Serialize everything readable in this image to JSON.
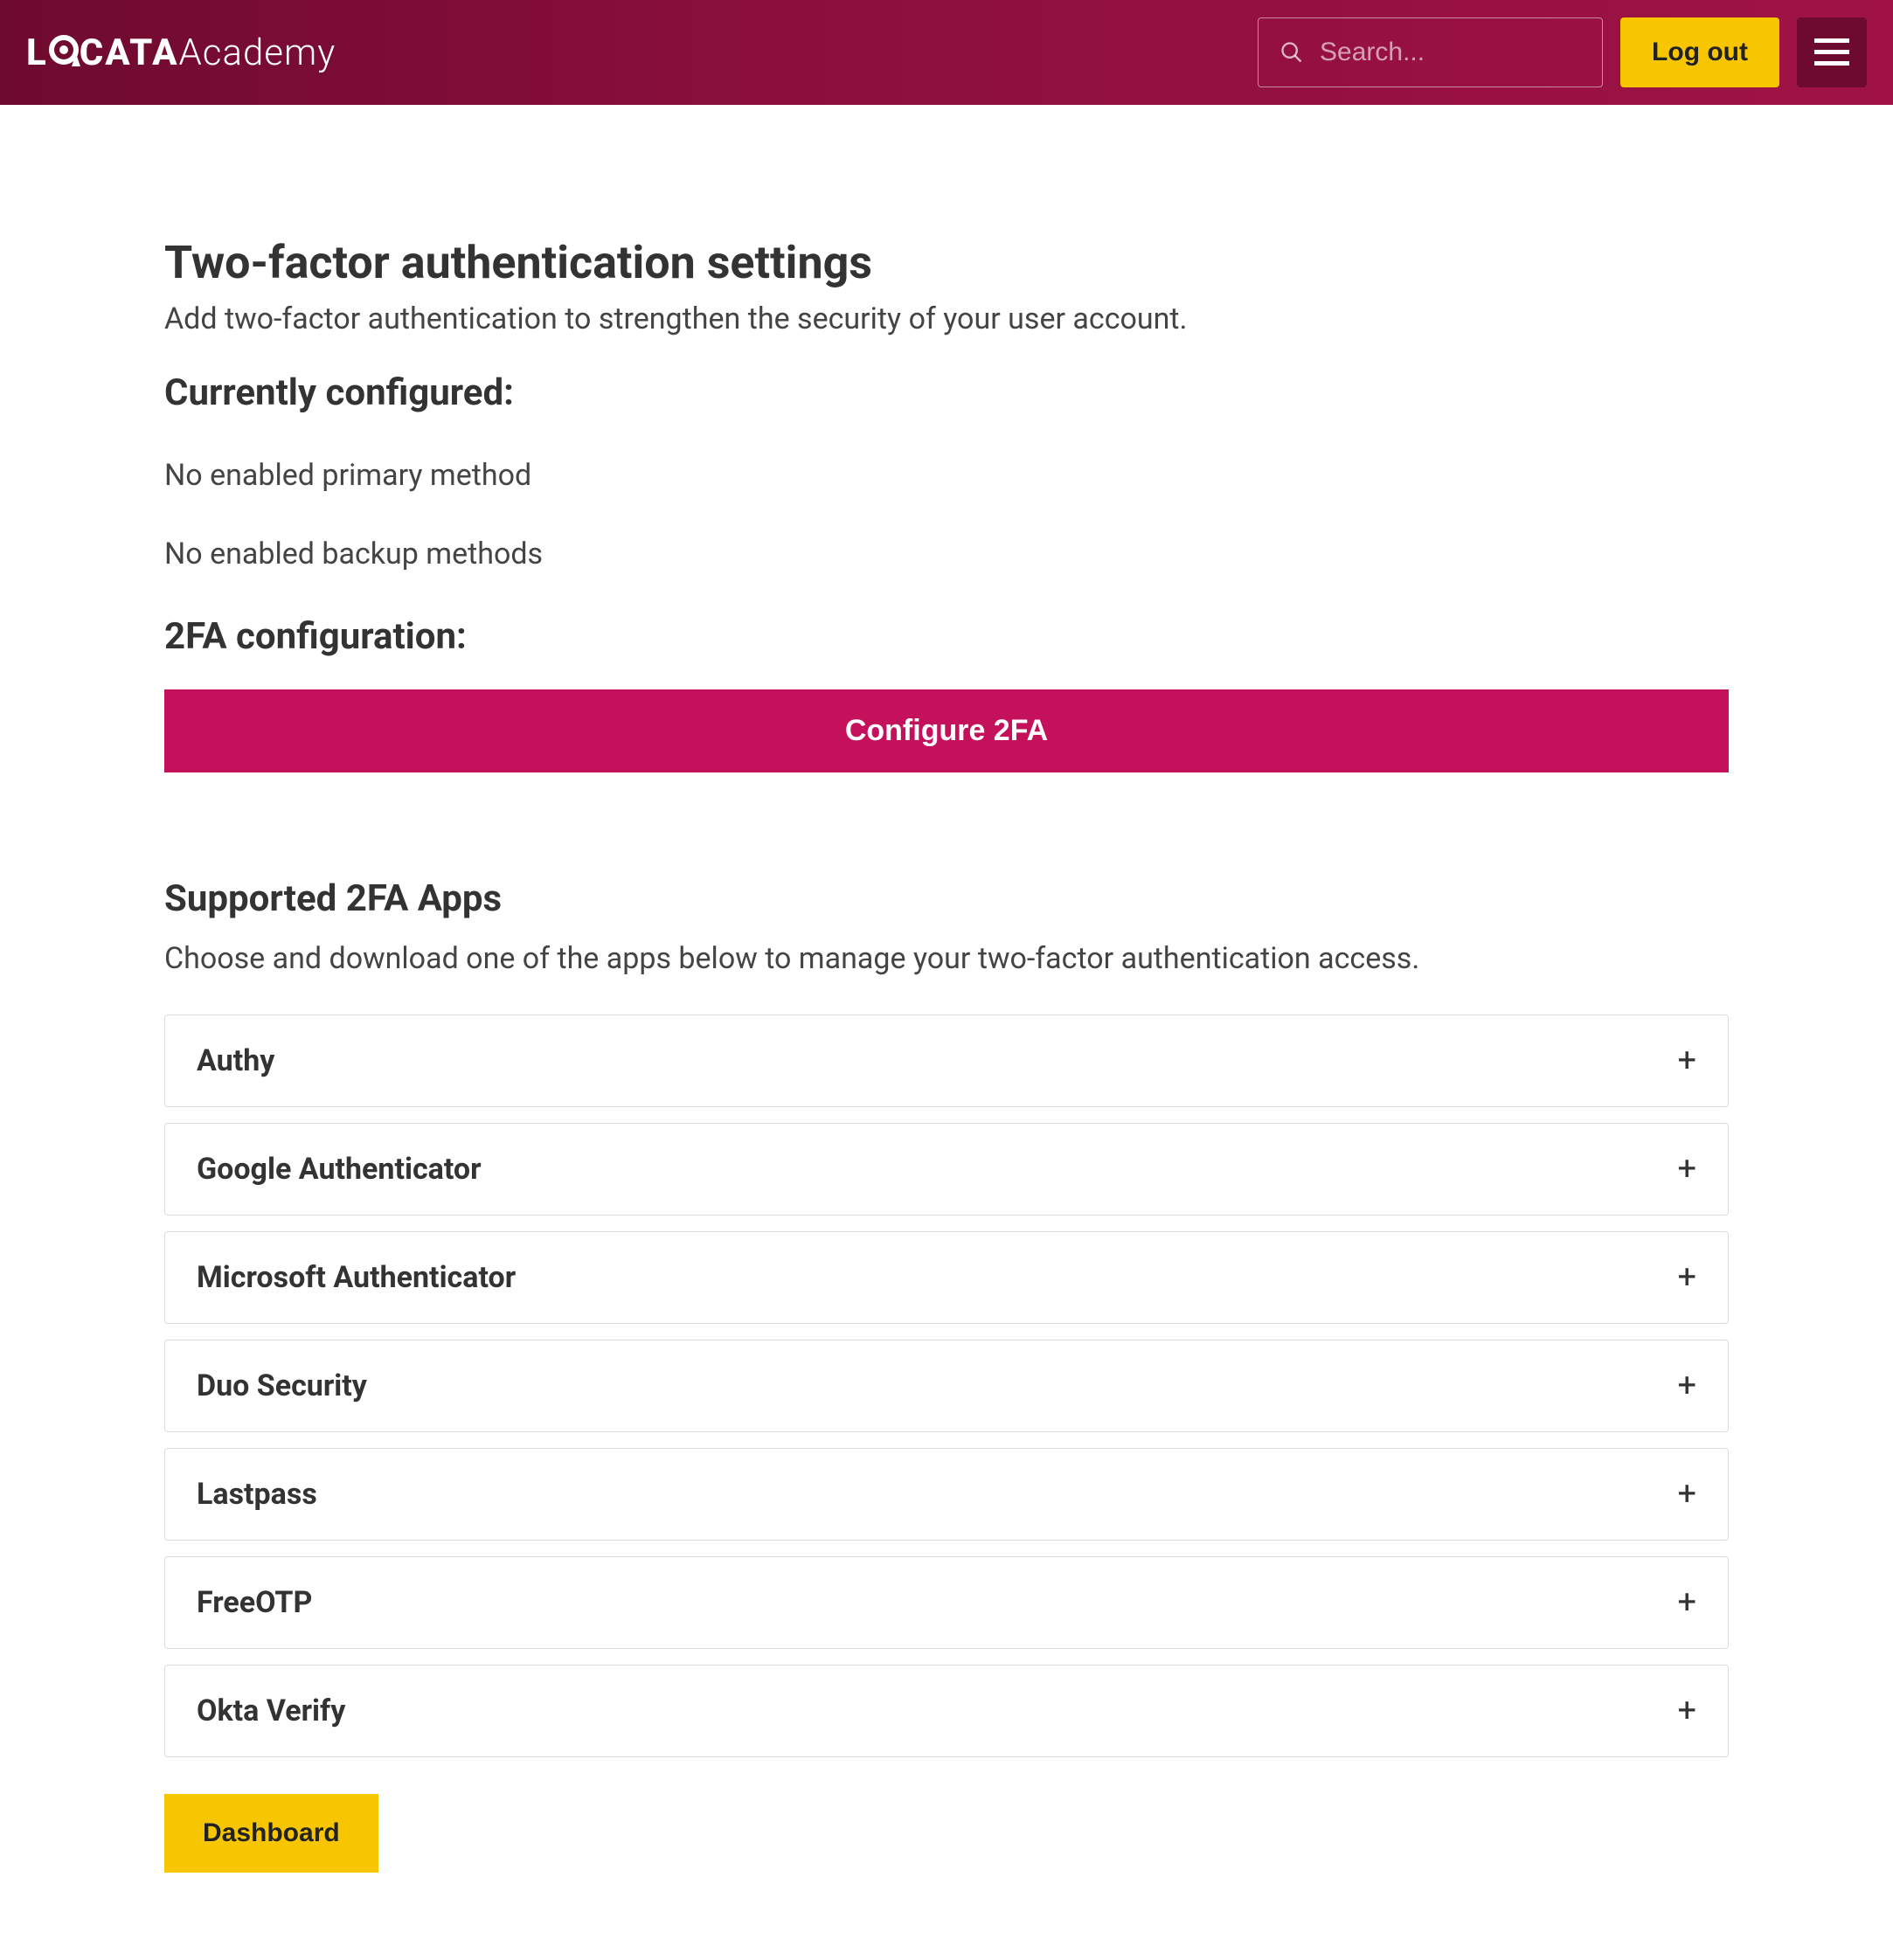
{
  "header": {
    "logo_bold_prefix": "L",
    "logo_bold_suffix": "CATA",
    "logo_light": "Academy",
    "search_placeholder": "Search...",
    "logout_label": "Log out"
  },
  "page": {
    "title": "Two-factor authentication settings",
    "subtitle": "Add two-factor authentication to strengthen the security of your user account.",
    "configured_heading": "Currently configured:",
    "primary_status": "No enabled primary method",
    "backup_status": "No enabled backup methods",
    "config_heading": "2FA configuration:",
    "configure_button": "Configure 2FA",
    "apps_heading": "Supported 2FA Apps",
    "apps_subtitle": "Choose and download one of the apps below to manage your two-factor authentication access.",
    "dashboard_button": "Dashboard"
  },
  "apps": [
    {
      "name": "Authy"
    },
    {
      "name": "Google Authenticator"
    },
    {
      "name": "Microsoft Authenticator"
    },
    {
      "name": "Duo Security"
    },
    {
      "name": "Lastpass"
    },
    {
      "name": "FreeOTP"
    },
    {
      "name": "Okta Verify"
    }
  ]
}
